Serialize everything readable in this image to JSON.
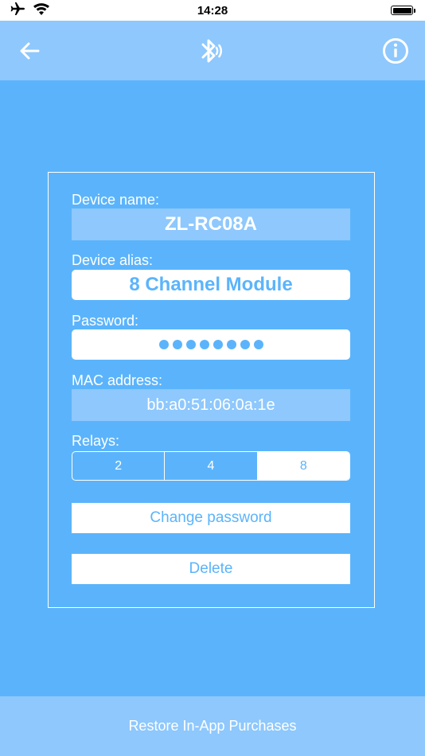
{
  "status_bar": {
    "time": "14:28",
    "icons": [
      "airplane-icon",
      "wifi-icon",
      "battery-icon"
    ]
  },
  "nav": {
    "back_icon": "arrow-left-icon",
    "center_icon": "bluetooth-audio-icon",
    "info_icon": "info-icon"
  },
  "device": {
    "name_label": "Device name:",
    "name_value": "ZL-RC08A",
    "alias_label": "Device alias:",
    "alias_value": "8 Channel Module",
    "password_label": "Password:",
    "password_length": 8,
    "mac_label": "MAC address:",
    "mac_value": "bb:a0:51:06:0a:1e",
    "relays_label": "Relays:",
    "relay_options": [
      "2",
      "4",
      "8"
    ],
    "relay_selected": "8"
  },
  "actions": {
    "change_password": "Change password",
    "delete": "Delete"
  },
  "footer": {
    "restore": "Restore In-App Purchases"
  },
  "colors": {
    "background": "#5bb4fb",
    "bar": "#8ec8fd",
    "white": "#ffffff"
  }
}
